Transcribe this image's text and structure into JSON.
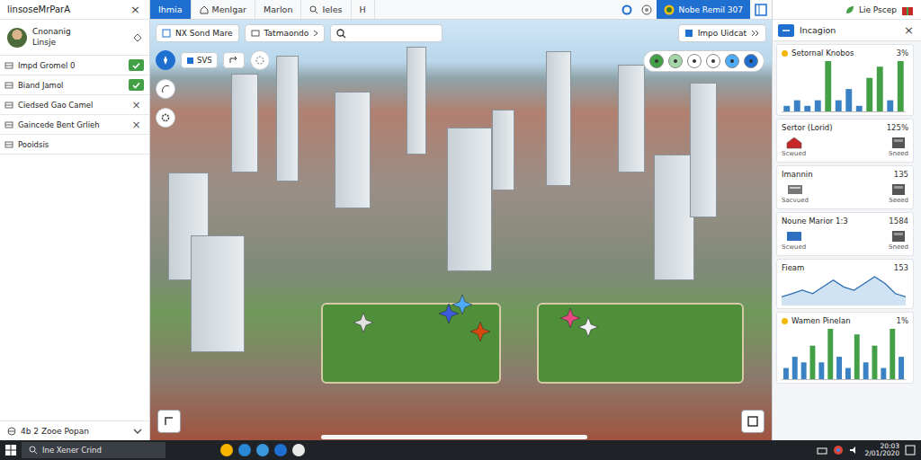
{
  "sidebar": {
    "title": "linsoseMrParA",
    "close": "×",
    "profile": {
      "name": "Cnonanig",
      "subtitle": "Linsje"
    },
    "items": [
      {
        "label": "Impd Gromel 0",
        "kind": "check",
        "checked": true
      },
      {
        "label": "Biand Jamol",
        "kind": "check",
        "checked": true
      },
      {
        "label": "Ciedsed Gao Camel",
        "kind": "remove",
        "icon": "×"
      },
      {
        "label": "Gaincede Bent Grlieh",
        "kind": "remove",
        "icon": "×"
      },
      {
        "label": "Pooidsis",
        "kind": "plain"
      }
    ],
    "footer": {
      "label": "4b 2 Zooe Popan"
    }
  },
  "tabs": [
    {
      "label": "Ihmia",
      "selected": true
    },
    {
      "label": "Menlgar",
      "selected": false
    },
    {
      "label": "Marlon",
      "selected": false
    },
    {
      "label": "Ieles",
      "selected": false
    },
    {
      "label": "H",
      "selected": false
    }
  ],
  "topbar": {
    "account": "Nobe Remil 307"
  },
  "toolbar": {
    "location": "NX Sond Mare",
    "dropdown": "Tatmaondo",
    "layer": "Impo Uidcat"
  },
  "map_tools": {
    "mode": "SVS"
  },
  "right_panel": {
    "user": "Lie Pscep",
    "title": "Incagion",
    "close": "×"
  },
  "cards": [
    {
      "kind": "bars",
      "title": "Setornal Knobos",
      "value": "3%",
      "values": [
        1,
        2,
        1,
        2,
        9,
        2,
        4,
        1,
        6,
        8,
        2,
        9
      ]
    },
    {
      "kind": "icons",
      "title": "Sertor (Lorid)",
      "value": "125%",
      "items": [
        "Scwued",
        "Sneed"
      ]
    },
    {
      "kind": "icons",
      "title": "Imannin",
      "value": "135",
      "items": [
        "Sacvued",
        "Seeed"
      ]
    },
    {
      "kind": "icons",
      "title": "Noune Marior 1:3",
      "value": "1584",
      "items": [
        "Scwued",
        "Sneed"
      ]
    },
    {
      "kind": "line",
      "title": "Fieam",
      "value": "153",
      "values": [
        2,
        3,
        4,
        3,
        5,
        7,
        5,
        4,
        6,
        8,
        6,
        3,
        2
      ]
    },
    {
      "kind": "bars",
      "title": "Wamen Pinelan",
      "value": "1%",
      "values": [
        2,
        4,
        3,
        6,
        3,
        9,
        4,
        2,
        8,
        3,
        6,
        2,
        9,
        4
      ]
    }
  ],
  "taskbar": {
    "search": "Ine Xener Crind",
    "time": "20:03",
    "date": "2/01/2020"
  }
}
